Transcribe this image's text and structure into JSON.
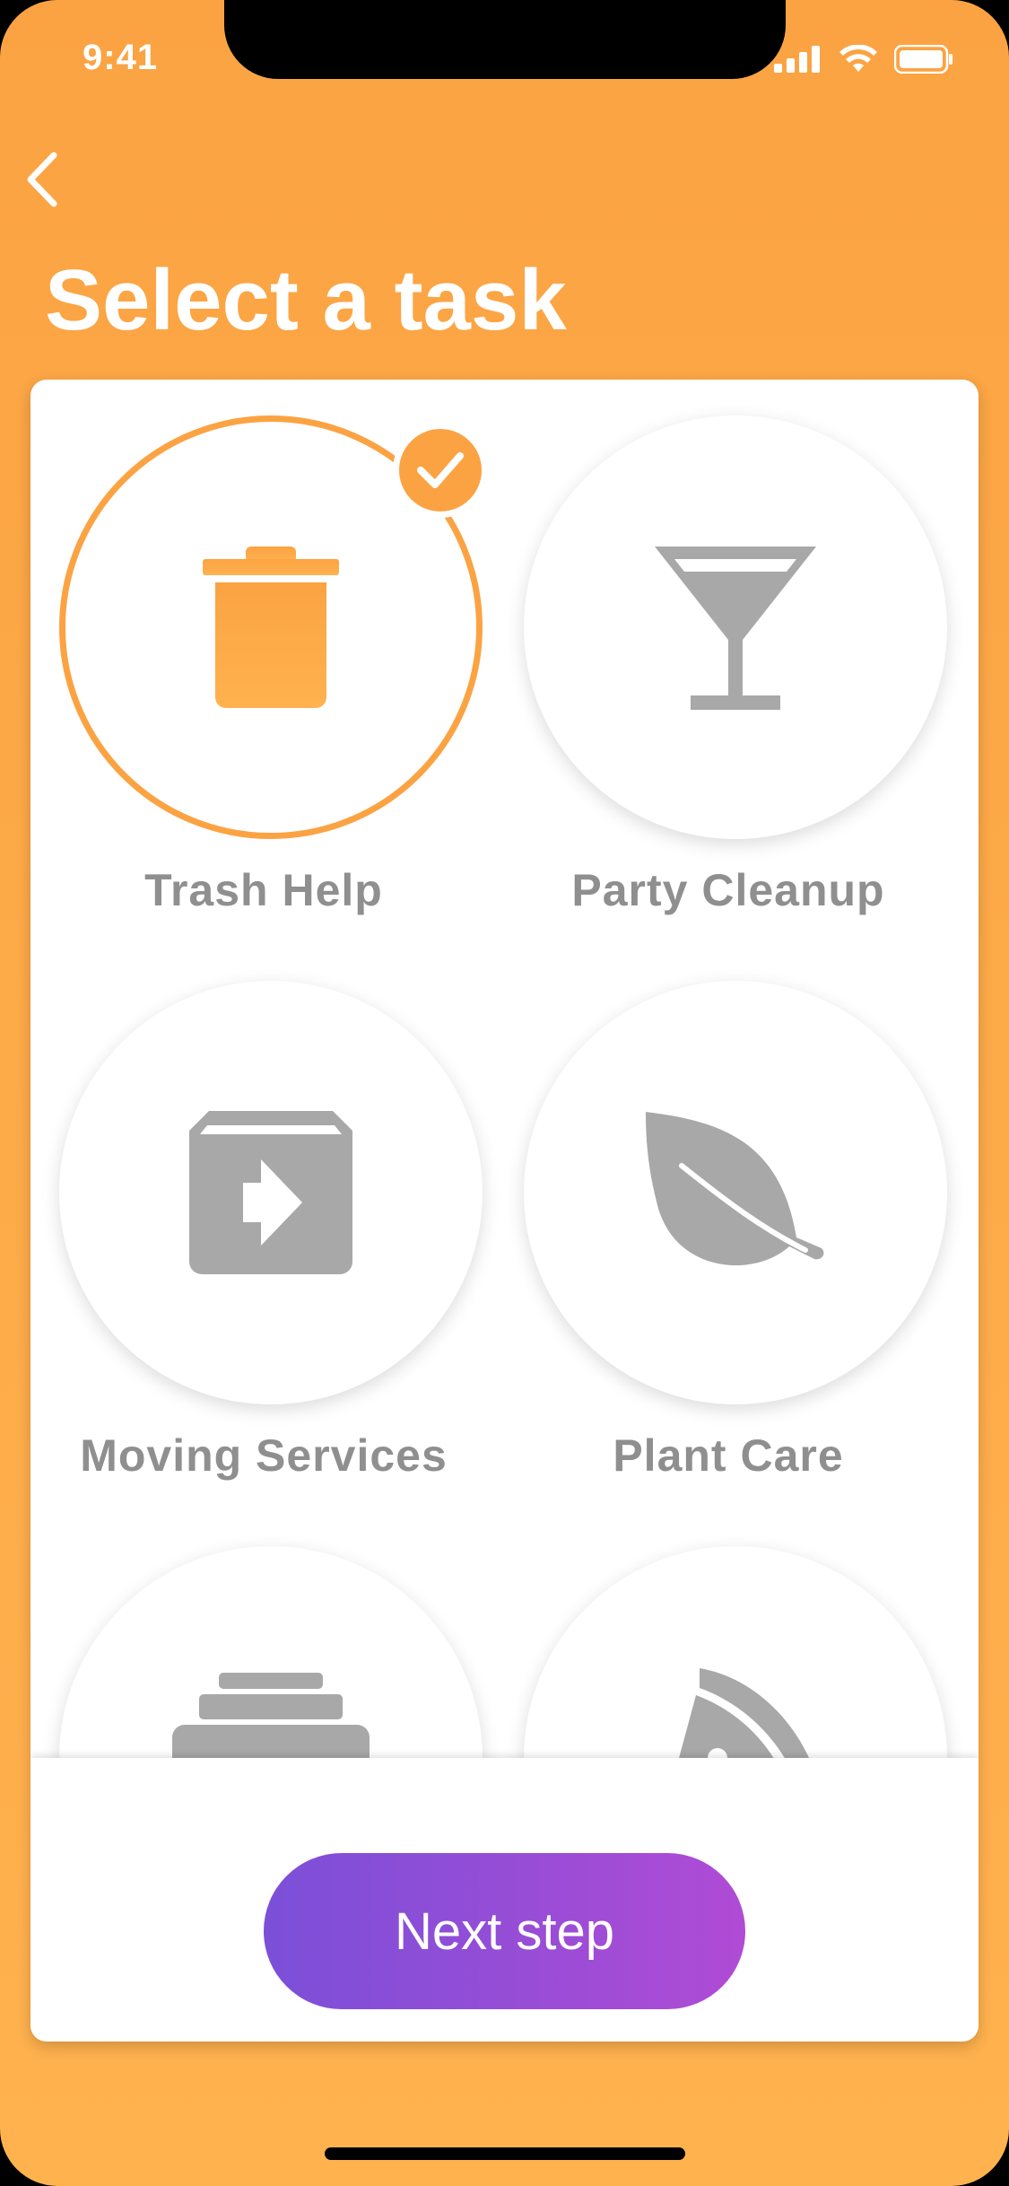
{
  "status_bar": {
    "time": "9:41"
  },
  "header": {
    "title": "Select a task"
  },
  "tasks": [
    {
      "label": "Trash Help",
      "icon": "trash-icon",
      "selected": true
    },
    {
      "label": "Party Cleanup",
      "icon": "cocktail-icon",
      "selected": false
    },
    {
      "label": "Moving Services",
      "icon": "box-arrow-icon",
      "selected": false
    },
    {
      "label": "Plant Care",
      "icon": "leaf-icon",
      "selected": false
    },
    {
      "label": "",
      "icon": "stack-icon",
      "selected": false
    },
    {
      "label": "",
      "icon": "pizza-icon",
      "selected": false
    }
  ],
  "footer": {
    "next_label": "Next step"
  },
  "colors": {
    "accent": "#FBA343",
    "icon_gray": "#A8A8A8",
    "button_start": "#7B4FD8",
    "button_end": "#B04BD5"
  }
}
